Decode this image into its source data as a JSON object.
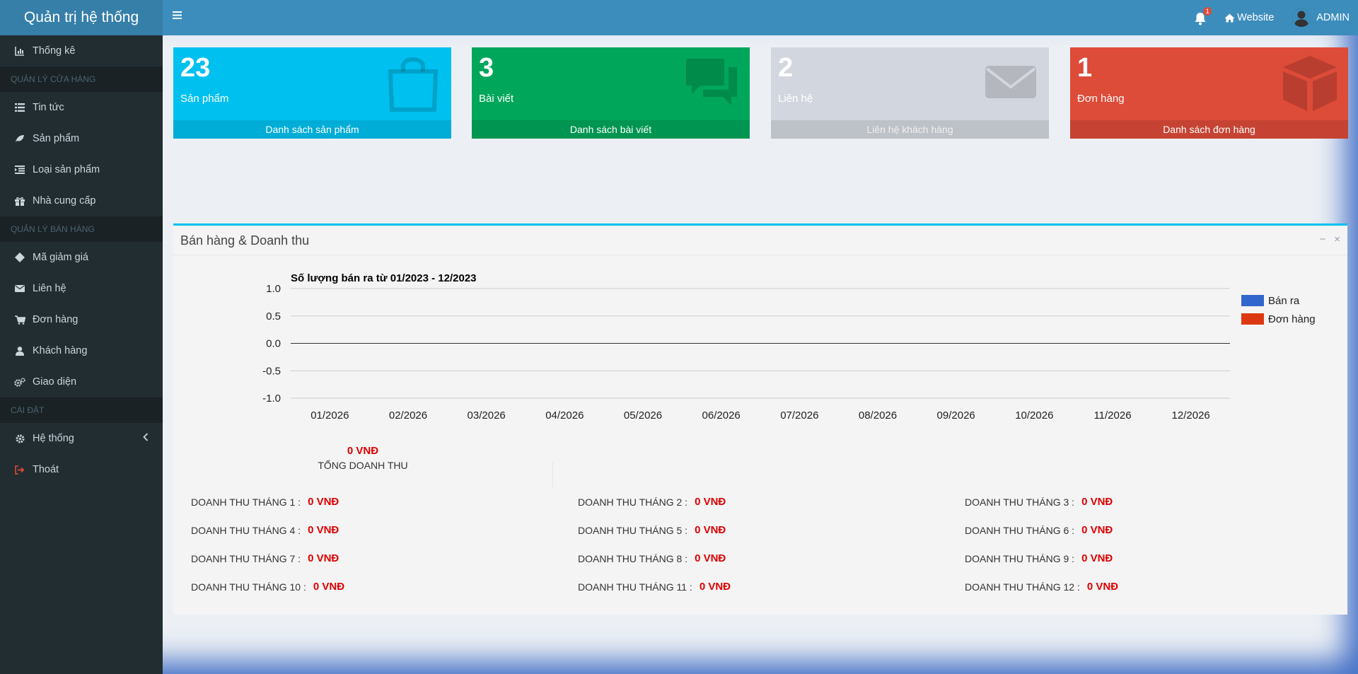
{
  "brand": "Quản trị hệ thống",
  "sidebar": {
    "stats": "Thống kê",
    "header_store": "QUẢN LÝ CỬA HÀNG",
    "news": "Tin tức",
    "products": "Sản phẩm",
    "categories": "Loại sản phẩm",
    "suppliers": "Nhà cung cấp",
    "header_sales": "QUẢN LÝ BÁN HÀNG",
    "coupons": "Mã giảm giá",
    "contacts": "Liên hệ",
    "orders": "Đơn hàng",
    "customers": "Khách hàng",
    "appearance": "Giao diện",
    "header_settings": "CÀI ĐẶT",
    "system": "Hệ thống",
    "logout": "Thoát"
  },
  "topbar": {
    "notif_count": "1",
    "website": "Website",
    "user": "ADMIN"
  },
  "boxes": [
    {
      "num": "23",
      "label": "Sản phẩm",
      "footer": "Danh sách sản phẩm",
      "color": "#00c0ef",
      "footer_color": "#00add7",
      "icon": "shopping-bag-icon"
    },
    {
      "num": "3",
      "label": "Bài viết",
      "footer": "Danh sách bài viết",
      "color": "#00a65a",
      "footer_color": "#009551",
      "icon": "comments-icon"
    },
    {
      "num": "2",
      "label": "Liên hệ",
      "footer": "Liên hệ khách hàng",
      "color": "#d2d6de",
      "footer_color": "#bdc1c8",
      "icon": "envelope-icon"
    },
    {
      "num": "1",
      "label": "Đơn hàng",
      "footer": "Danh sách đơn hàng",
      "color": "#dd4b39",
      "footer_color": "#c64333",
      "icon": "cube-icon"
    }
  ],
  "panel": {
    "title": "Bán hàng & Doanh thu",
    "minimize": "−",
    "close": "×"
  },
  "chart_data": {
    "type": "line",
    "title": "Số lượng bán ra từ 01/2023 - 12/2023",
    "categories": [
      "01/2026",
      "02/2026",
      "03/2026",
      "04/2026",
      "05/2026",
      "06/2026",
      "07/2026",
      "08/2026",
      "09/2026",
      "10/2026",
      "11/2026",
      "12/2026"
    ],
    "series": [
      {
        "name": "Bán ra",
        "color": "#3366cc",
        "values": [
          0,
          0,
          0,
          0,
          0,
          0,
          0,
          0,
          0,
          0,
          0,
          0
        ]
      },
      {
        "name": "Đơn hàng",
        "color": "#dc3912",
        "values": [
          0,
          0,
          0,
          0,
          0,
          0,
          0,
          0,
          0,
          0,
          0,
          0
        ]
      }
    ],
    "yticks": [
      "1.0",
      "0.5",
      "0.0",
      "-0.5",
      "-1.0"
    ],
    "ylim": [
      -1,
      1
    ],
    "grid": true,
    "legend": "right"
  },
  "revenue": {
    "total_value": "0 VNĐ",
    "total_label": "TỔNG DOANH THU",
    "months": [
      {
        "label": "DOANH THU THÁNG 1 :",
        "value": "0 VNĐ"
      },
      {
        "label": "DOANH THU THÁNG 2 :",
        "value": "0 VNĐ"
      },
      {
        "label": "DOANH THU THÁNG 3 :",
        "value": "0 VNĐ"
      },
      {
        "label": "DOANH THU THÁNG 4 :",
        "value": "0 VNĐ"
      },
      {
        "label": "DOANH THU THÁNG 5 :",
        "value": "0 VNĐ"
      },
      {
        "label": "DOANH THU THÁNG 6 :",
        "value": "0 VNĐ"
      },
      {
        "label": "DOANH THU THÁNG 7 :",
        "value": "0 VNĐ"
      },
      {
        "label": "DOANH THU THÁNG 8 :",
        "value": "0 VNĐ"
      },
      {
        "label": "DOANH THU THÁNG 9 :",
        "value": "0 VNĐ"
      },
      {
        "label": "DOANH THU THÁNG 10 :",
        "value": "0 VNĐ"
      },
      {
        "label": "DOANH THU THÁNG 11 :",
        "value": "0 VNĐ"
      },
      {
        "label": "DOANH THU THÁNG 12 :",
        "value": "0 VNĐ"
      }
    ]
  }
}
